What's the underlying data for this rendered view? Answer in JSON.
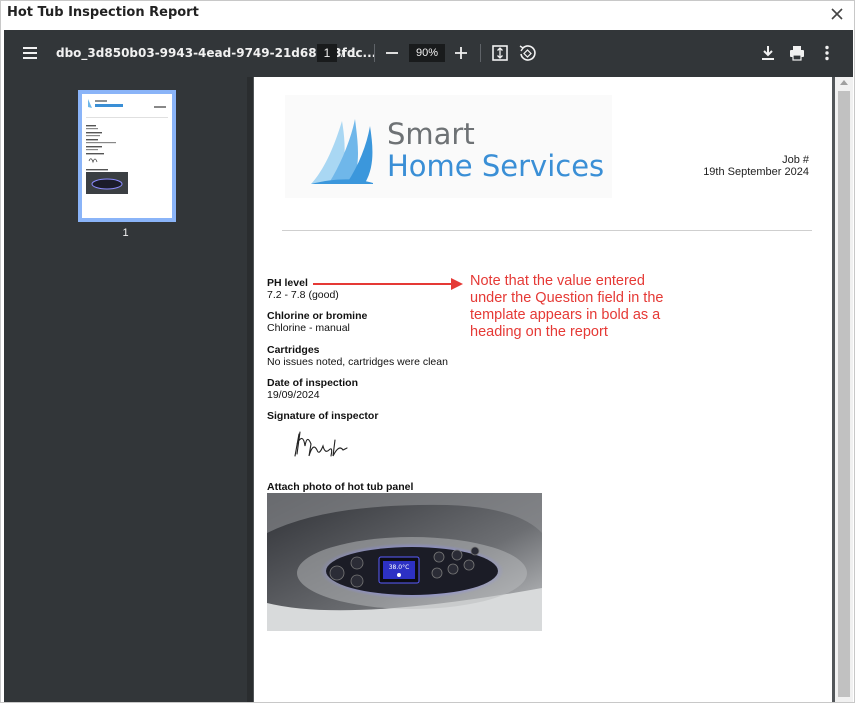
{
  "window": {
    "title": "Hot Tub Inspection Report"
  },
  "toolbar": {
    "filename": "dbo_3d850b03-9943-4ead-9749-21d68583fdc...",
    "page_current": "1",
    "page_separator": "/",
    "page_total": "1",
    "zoom": "90%"
  },
  "sidebar": {
    "thumbnail_label": "1"
  },
  "report": {
    "logo": {
      "line1": "Smart",
      "line2": "Home Services"
    },
    "job_label": "Job #",
    "date": "19th September 2024",
    "fields": [
      {
        "question": "PH level",
        "answer": "7.2 - 7.8 (good)"
      },
      {
        "question": "Chlorine or bromine",
        "answer": "Chlorine - manual"
      },
      {
        "question": "Cartridges",
        "answer": "No issues noted, cartridges were clean"
      },
      {
        "question": "Date of inspection",
        "answer": "19/09/2024"
      }
    ],
    "signature_label": "Signature of inspector",
    "photo_label": "Attach photo of hot tub panel",
    "photo_display_temp": "38.0°C"
  },
  "annotation": {
    "text": "Note that the value entered under the Question field in the template appears in bold as a heading on the report",
    "color": "#e53935"
  },
  "colors": {
    "viewer_bg": "#525659",
    "toolbar_bg": "#323639",
    "accent": "#8ab4f8",
    "brand_blue": "#3a8fd6"
  }
}
